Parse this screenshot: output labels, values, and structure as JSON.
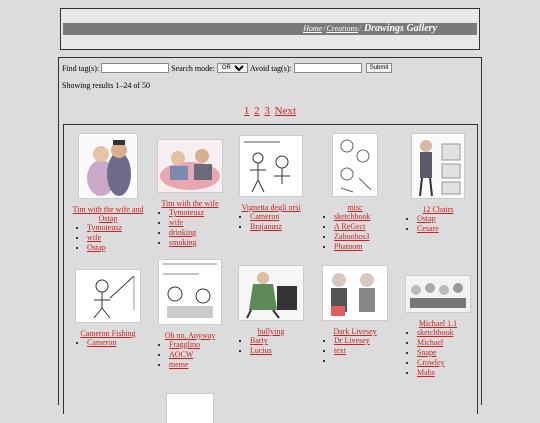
{
  "header": {
    "breadcrumb_home": "Home",
    "separator": "/",
    "breadcrumb_creations": "Creations",
    "title": "Drawings Gallery"
  },
  "search": {
    "find_label": "Find tag(s):",
    "mode_label": "Search mode:",
    "mode_value": "OR",
    "avoid_label": "Avoid tag(s):",
    "submit_label": "Submit"
  },
  "results_text": "Showing results 1–24 of 50",
  "pagination": {
    "pages": [
      "1",
      "2",
      "3"
    ],
    "next": "Next"
  },
  "gallery": [
    {
      "title": "Tim with the wife and Ostap",
      "tags": [
        "Tymoteusz",
        "wife",
        "Ostap"
      ],
      "thumb_color": "#c9a8c8"
    },
    {
      "title": "Tim with the wife",
      "tags": [
        "Tymoteusz",
        "wife",
        "drinking",
        "smoking"
      ],
      "thumb_color": "#e9a6b0"
    },
    {
      "title": "Vignetta degli orsi",
      "tags": [
        "Cameron",
        "Brajanusz"
      ],
      "thumb_color": "#f4f4f4"
    },
    {
      "title": "misc",
      "tags": [
        "sketchbook",
        "A ReGect",
        "Zaboobos3",
        "Phatnom"
      ],
      "thumb_color": "#f4f4f4"
    },
    {
      "title": "12 Chairs",
      "tags": [
        "Ostap",
        "Cesare"
      ],
      "thumb_color": "#e8e8e8"
    },
    {
      "title": "Cameron Fishing",
      "tags": [
        "Cameron"
      ],
      "thumb_color": "#f4f4f4"
    },
    {
      "title": "Oh no, Anyway",
      "tags": [
        "Fragglino",
        "AOCW",
        "meme"
      ],
      "thumb_color": "#f4f4f4"
    },
    {
      "title": "bullying",
      "tags": [
        "Barty",
        "Lucius"
      ],
      "thumb_color": "#5e8a5a"
    },
    {
      "title": "Dark Livesey",
      "tags": [
        "Dr Livesey",
        "text"
      ],
      "thumb_color": "#d8d0d0"
    },
    {
      "title": "Michael 1.1",
      "tags": [
        "sketchbook",
        "Michael",
        "Snape",
        "Crowley",
        "Mabs"
      ],
      "thumb_color": "#e6e6e6"
    }
  ]
}
